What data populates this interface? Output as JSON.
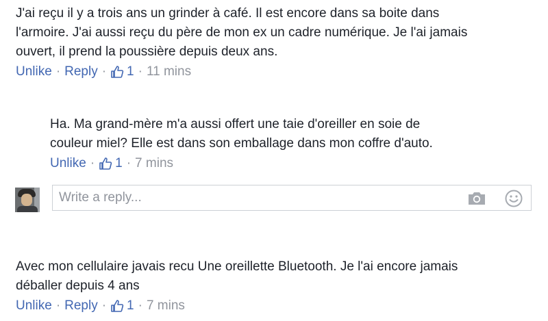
{
  "comments": [
    {
      "lines": [
        "J'ai reçu il y a trois ans un grinder à café. Il est encore dans sa boite dans",
        "l'armoire. J'ai aussi reçu du père de mon ex un cadre numérique. Je l'ai jamais",
        "ouvert, il prend la poussière depuis deux ans."
      ],
      "unlike": "Unlike",
      "reply": "Reply",
      "likes": "1",
      "time": "11 mins"
    },
    {
      "lines": [
        "Ha. Ma grand-mère m'a aussi offert une taie d'oreiller en soie de",
        "couleur miel? Elle est dans son emballage dans mon coffre d'auto."
      ],
      "unlike": "Unlike",
      "likes": "1",
      "time": "7 mins"
    },
    {
      "lines": [
        "Avec mon cellulaire javais recu Une oreillette Bluetooth. Je l'ai encore jamais",
        "déballer depuis 4 ans"
      ],
      "unlike": "Unlike",
      "reply": "Reply",
      "likes": "1",
      "time": "7 mins"
    }
  ],
  "reply_box": {
    "placeholder": "Write a reply...",
    "camera_icon": "camera-icon",
    "emoji_icon": "smiley-icon"
  },
  "separator": "·",
  "colors": {
    "link": "#4267b2",
    "meta": "#90949c",
    "text": "#1d2129"
  }
}
